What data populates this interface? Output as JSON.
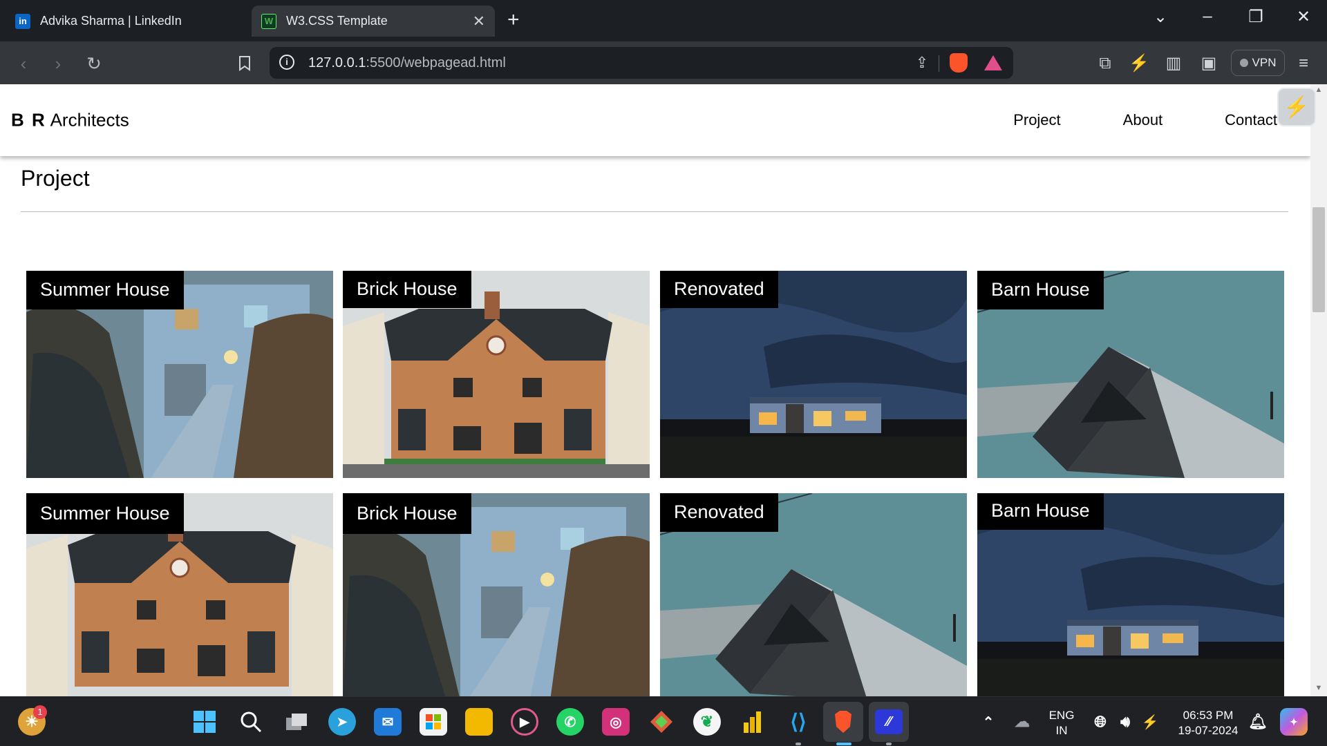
{
  "browser": {
    "tabs": [
      {
        "title": "Advika Sharma | LinkedIn",
        "icon": "linkedin-icon",
        "active": false
      },
      {
        "title": "W3.CSS Template",
        "icon": "w3-icon",
        "active": true
      }
    ],
    "url_host": "127.0.0.1",
    "url_path": ":5500/webpagead.html",
    "vpn_label": "VPN"
  },
  "site": {
    "brand_bold": "B R",
    "brand_rest": "Architects",
    "nav": [
      "Project",
      "About",
      "Contact"
    ]
  },
  "section": {
    "title": "Project"
  },
  "cards": [
    {
      "label": "Summer House",
      "image": "reeds-walkway"
    },
    {
      "label": "Brick House",
      "image": "brick-house"
    },
    {
      "label": "Renovated",
      "image": "night-cabin"
    },
    {
      "label": "Barn House",
      "image": "barn-roof"
    },
    {
      "label": "Summer House",
      "image": "brick-house"
    },
    {
      "label": "Brick House",
      "image": "reeds-walkway"
    },
    {
      "label": "Renovated",
      "image": "barn-roof"
    },
    {
      "label": "Barn House",
      "image": "night-cabin"
    }
  ],
  "taskbar": {
    "notification_count": "1",
    "lang_top": "ENG",
    "lang_bottom": "IN",
    "time": "06:53 PM",
    "date": "19-07-2024"
  },
  "colors": {
    "tabbar": "#1c1f23",
    "toolbar": "#34373c",
    "taskbar": "#1f2125",
    "tag_bg": "#000000"
  }
}
